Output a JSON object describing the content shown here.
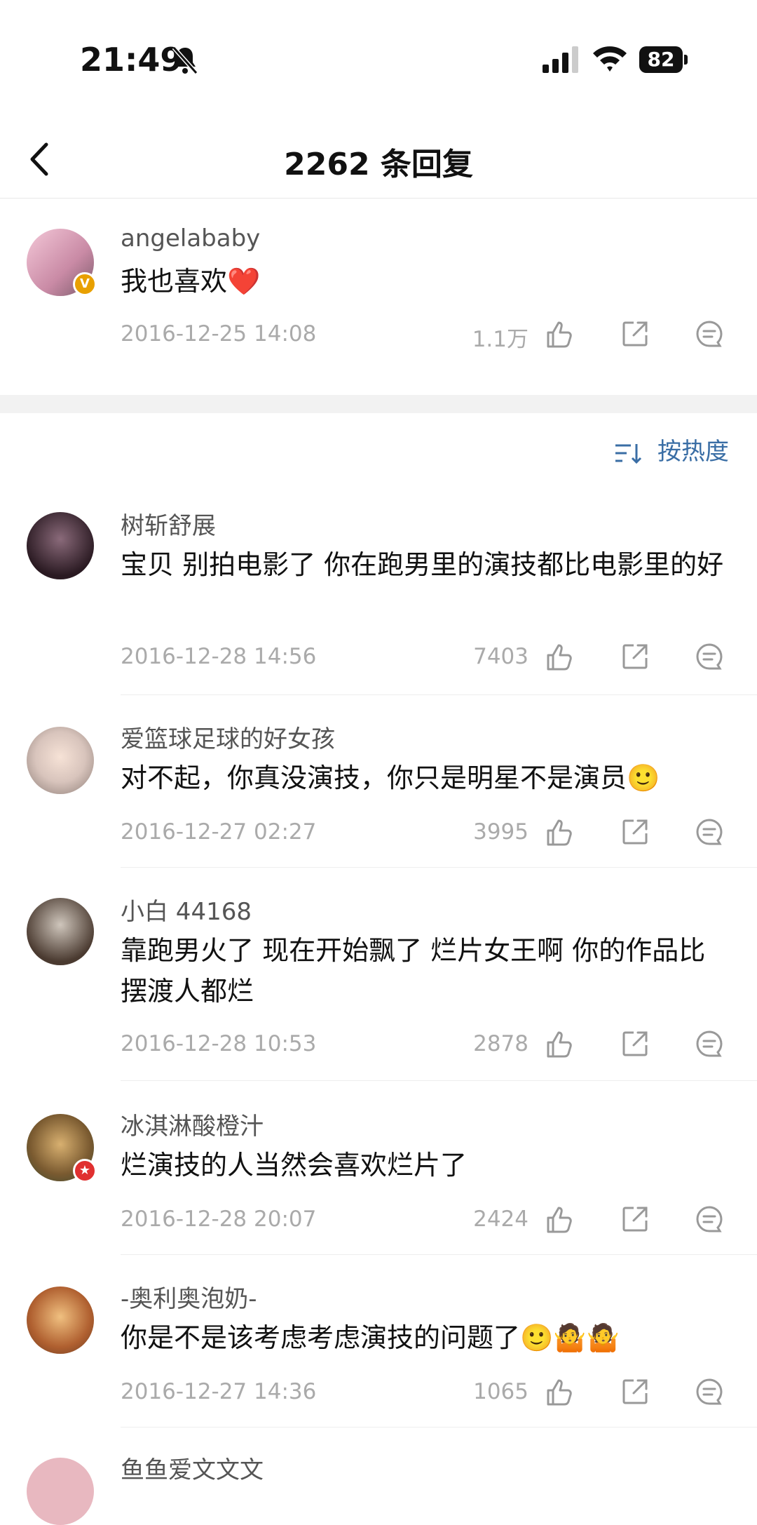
{
  "status_bar": {
    "time": "21:49",
    "battery": "82"
  },
  "header": {
    "title": "2262 条回复"
  },
  "main_post": {
    "username": "angelababy",
    "text": "我也喜欢❤️",
    "date": "2016-12-25 14:08",
    "likes": "1.1万"
  },
  "sort": {
    "label": "按热度"
  },
  "comments": [
    {
      "username": "树斩舒展",
      "text": "宝贝  别拍电影了  你在跑男里的演技都比电影里的好",
      "date": "2016-12-28 14:56",
      "likes": "7403"
    },
    {
      "username": "爱篮球足球的好女孩",
      "text": "对不起，你真没演技，你只是明星不是演员🙂",
      "date": "2016-12-27 02:27",
      "likes": "3995"
    },
    {
      "username": "小白 44168",
      "text": "靠跑男火了 现在开始飘了 烂片女王啊 你的作品比摆渡人都烂",
      "date": "2016-12-28 10:53",
      "likes": "2878"
    },
    {
      "username": "冰淇淋酸橙汁",
      "text": "烂演技的人当然会喜欢烂片了",
      "date": "2016-12-28 20:07",
      "likes": "2424"
    },
    {
      "username": "-奥利奥泡奶-",
      "text": "你是不是该考虑考虑演技的问题了🙂🤷🤷",
      "date": "2016-12-27 14:36",
      "likes": "1065"
    },
    {
      "username": "鱼鱼爱文文文",
      "text": "",
      "date": "",
      "likes": ""
    }
  ],
  "colors": {
    "accent": "#3a6ea5",
    "meta_gray": "#aaaaaa",
    "badge_verified": "#e8a000",
    "badge_red": "#e03030"
  },
  "icons": [
    "back-arrow-icon",
    "bell-mute-icon",
    "signal-icon",
    "wifi-icon",
    "battery-icon",
    "like-icon",
    "share-icon",
    "reply-icon",
    "sort-icon"
  ]
}
